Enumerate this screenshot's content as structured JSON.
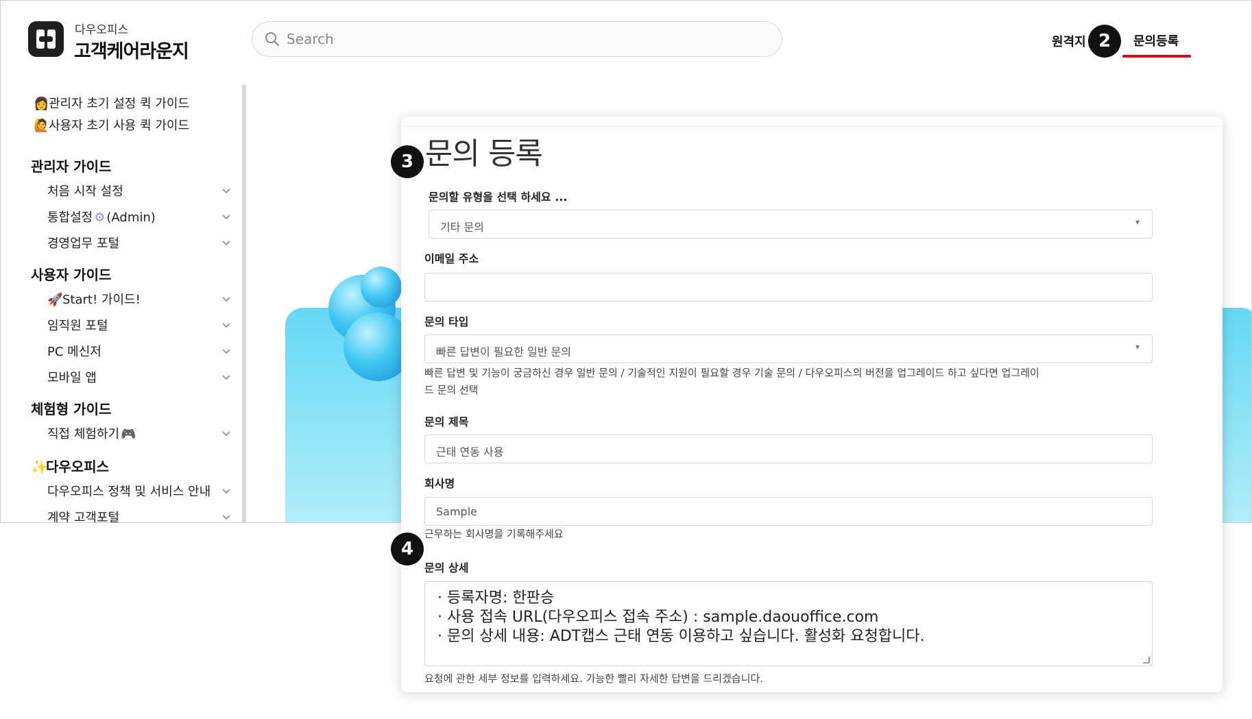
{
  "brand": {
    "small": "다우오피스",
    "big": "고객케어라운지"
  },
  "search": {
    "placeholder": "Search"
  },
  "nav": {
    "remote": "원격지",
    "inquiry": "문의등록"
  },
  "steps": [
    "2",
    "3",
    "4"
  ],
  "sidebar": {
    "quick1": "관리자 초기 설정 퀵 가이드",
    "quick2": "사용자 초기 사용 퀵 가이드",
    "admin_head": "관리자 가이드",
    "admin_items": [
      "처음 시작 설정",
      "통합설정",
      "(Admin)",
      "경영업무 포털"
    ],
    "user_head": "사용자 가이드",
    "user_items": [
      "Start! 가이드!",
      "임직원 포털",
      "PC 메신저",
      "모바일 앱"
    ],
    "exp_head": "체험형 가이드",
    "exp_items": [
      "직접 체험하기"
    ],
    "daou_head": "다우오피스",
    "daou_items": [
      "다우오피스 정책 및 서비스 안내",
      "계약 고객포털"
    ]
  },
  "form": {
    "title": "문의 등록",
    "type_label": "문의할 유형을 선택 하세요 ...",
    "type_value": "기타 문의",
    "email_label": "이메일 주소",
    "email_value": "",
    "inquiry_type_label": "문의 타입",
    "inquiry_type_value": "빠른 답변이 필요한 일반 문의",
    "inquiry_type_hint_1": "빠른 답변 및 기능이 궁금하신 경우 일반 문의 / 기술적인 지원이 필요할 경우 기술 문의 / 다우오피스의 버전을 업그레이드 하고 싶다면 업그레이",
    "inquiry_type_hint_2": "드 문의 선택",
    "subject_label": "문의 제목",
    "subject_value": "근태 연동 사용",
    "company_label": "회사명",
    "company_value": "Sample",
    "company_hint": "근무하는 회사명을 기록해주세요",
    "detail_label": "문의 상세",
    "detail_lines": [
      "· 등록자명: 한판승",
      "· 사용 접속 URL(다우오피스 접속 주소) : sample.daouoffice.com",
      "· 문의 상세 내용: ADT캡스 근태 연동 이용하고 싶습니다. 활성화 요청합니다."
    ],
    "detail_hint": "요청에 관한 세부 정보를 입력하세요. 가능한 빨리 자세한 답변을 드리겠습니다."
  }
}
